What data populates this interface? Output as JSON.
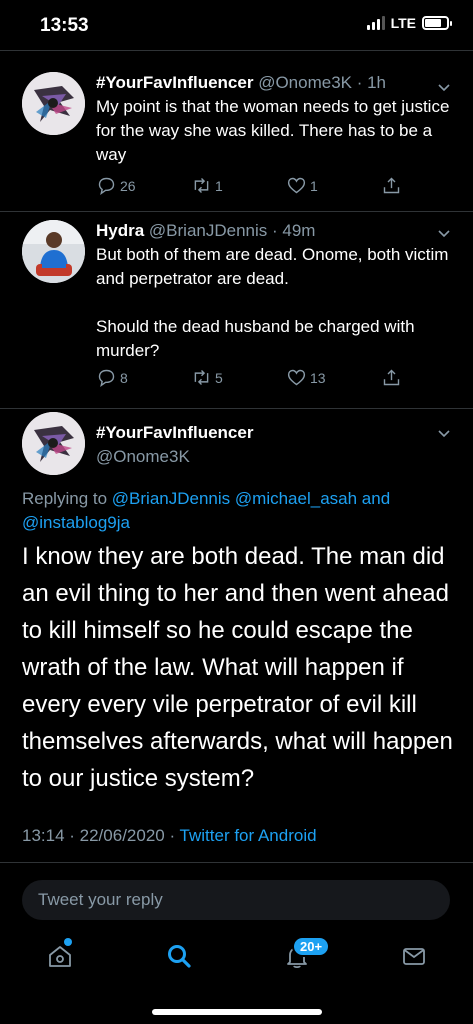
{
  "status_bar": {
    "time": "13:53",
    "network": "LTE"
  },
  "tweets": [
    {
      "name": "#YourFavInfluencer",
      "handle": "@Onome3K · 1h",
      "text": [
        "My point is that the woman needs to get justice for the way she was killed. There has to be a way"
      ],
      "replies": "26",
      "retweets": "1",
      "likes": "1"
    },
    {
      "name": "Hydra",
      "handle": "@BrianJDennis · 49m",
      "text": [
        "But both of them are dead. Onome, both victim and perpetrator are dead.",
        "Should the dead husband be charged with murder?"
      ],
      "replies": "8",
      "retweets": "5",
      "likes": "13"
    }
  ],
  "main_tweet": {
    "name": "#YourFavInfluencer",
    "handle": "@Onome3K",
    "replying_prefix": "Replying to",
    "mentions": [
      "@BrianJDennis",
      "@michael_asah",
      "@instablog9ja"
    ],
    "mention_joiner": "and",
    "text": "I know they are both dead. The man did an evil thing to her and then went ahead to kill himself so he could escape the wrath of the law. What will happen if every every vile perpetrator of evil kill themselves afterwards, what will happen to our justice system?",
    "timestamp": "13:14 · 22/06/2020 ·",
    "client": "Twitter for Android"
  },
  "reply_box": {
    "placeholder": "Tweet your reply"
  },
  "tab_bar": {
    "tabs": [
      "home-icon",
      "search-icon",
      "notifications-icon",
      "messages-icon"
    ],
    "active": "search-icon",
    "notifications_badge": "20+"
  },
  "colors": {
    "accent": "#1da1f2",
    "muted": "#8899a6",
    "background": "#000000",
    "divider": "#2f3336"
  }
}
